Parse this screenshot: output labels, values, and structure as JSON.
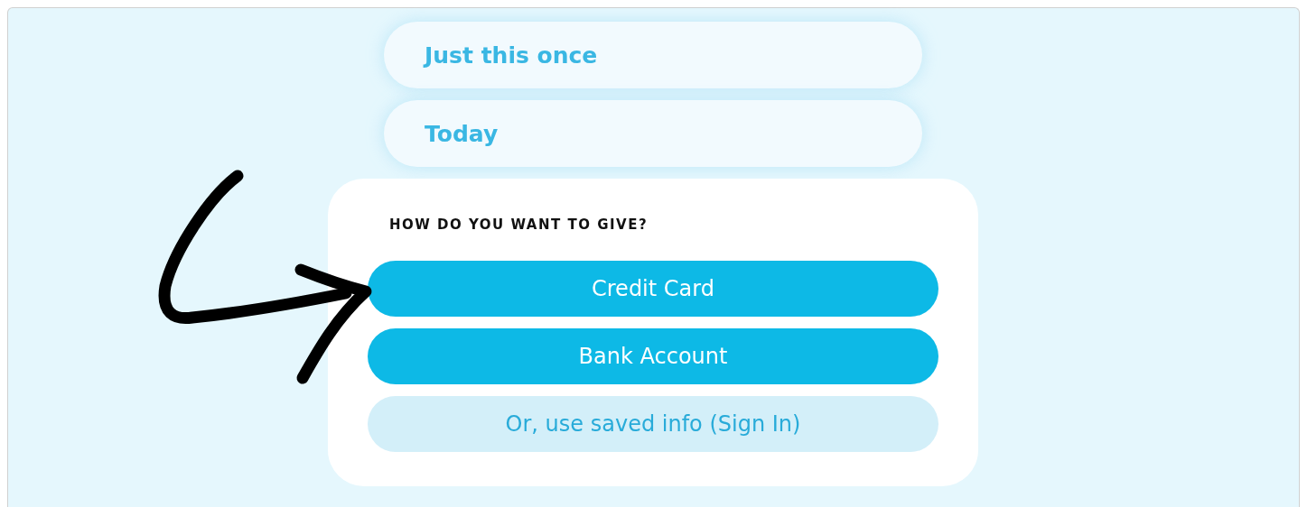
{
  "frequency_options": [
    {
      "label": "Just this once"
    },
    {
      "label": "Today"
    }
  ],
  "give_card": {
    "heading": "HOW DO YOU WANT TO GIVE?",
    "buttons": [
      {
        "label": "Credit Card",
        "kind": "primary"
      },
      {
        "label": "Bank Account",
        "kind": "primary"
      },
      {
        "label": "Or, use saved info (Sign In)",
        "kind": "secondary"
      }
    ]
  }
}
